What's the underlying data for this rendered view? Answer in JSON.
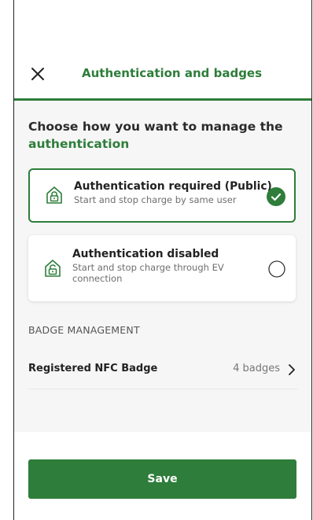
{
  "header": {
    "title": "Authentication and badges",
    "close_icon": "close-icon"
  },
  "intro": {
    "text_part1": "Choose how you want to manage the",
    "text_part2": "authentication"
  },
  "options": [
    {
      "title": "Authentication required (Public)",
      "description": "Start and stop charge by same user",
      "selected": true,
      "icon": "lock-shield-icon"
    },
    {
      "title": "Authentication disabled",
      "description": "Start and stop charge through EV connection",
      "selected": false,
      "icon": "unlock-shield-icon"
    }
  ],
  "badge_management": {
    "section_label": "BADGE MANAGEMENT",
    "row_label": "Registered NFC Badge",
    "row_value": "4 badges"
  },
  "footer": {
    "save_label": "Save"
  },
  "colors": {
    "accent": "#2e7d3a",
    "background": "#f6f6f6"
  }
}
